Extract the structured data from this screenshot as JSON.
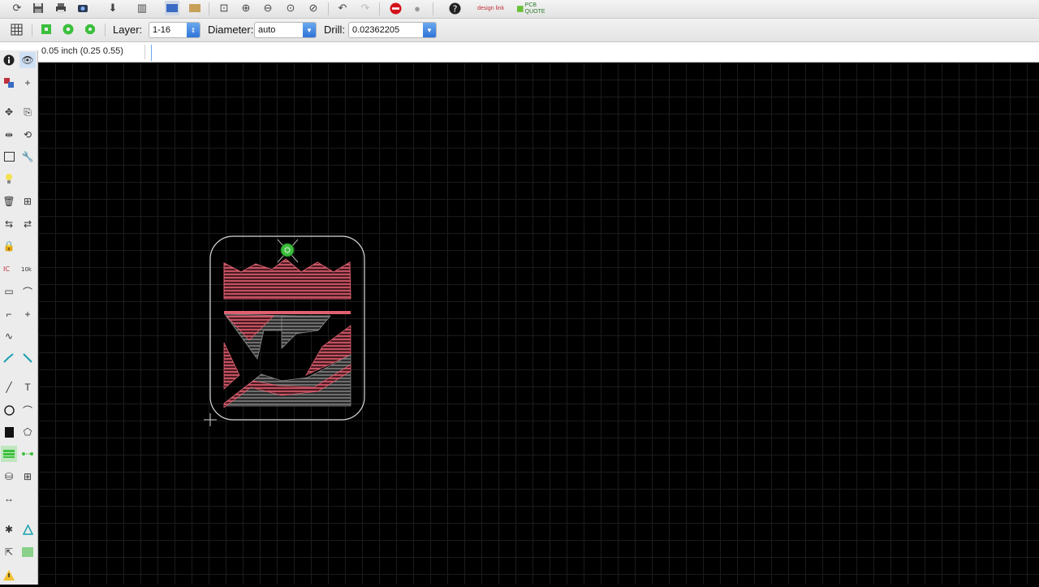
{
  "toolbar": {
    "layer_label": "Layer:",
    "layer_value": "1-16",
    "diameter_label": "Diameter:",
    "diameter_value": "auto",
    "drill_label": "Drill:",
    "drill_value": "0.02362205",
    "designlink_text": "design link",
    "pcbquote_text": "PCB QUOTE"
  },
  "command_bar": {
    "coordinate_readout": "0.05 inch (0.25 0.55)",
    "command_value": ""
  },
  "colors": {
    "accent": "#2f74d8",
    "top_layer": "#e06070",
    "bottom_layer": "#8a8a8a",
    "outline": "#d8d8d8",
    "via": "#3cbf3c"
  }
}
